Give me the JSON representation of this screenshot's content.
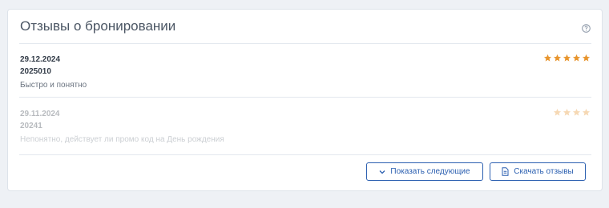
{
  "widget": {
    "title": "Отзывы о бронировании",
    "help_icon": "question-circle-icon"
  },
  "reviews": [
    {
      "date": "29.12.2024",
      "booking_id": "2025010",
      "text": "Быстро и понятно",
      "rating": 5,
      "rating_max": 5
    },
    {
      "date": "29.11.2024",
      "booking_id": "20241",
      "text": "Непонятно, действует ли промо код на День рождения",
      "rating": 4,
      "rating_max": 4
    }
  ],
  "buttons": {
    "show_next": {
      "label": "Показать следующие",
      "icon": "chevron-down-icon"
    },
    "download": {
      "label": "Скачать отзывы",
      "icon": "document-icon"
    }
  },
  "colors": {
    "accent": "#2b5fb0",
    "star": "#e8952e"
  }
}
